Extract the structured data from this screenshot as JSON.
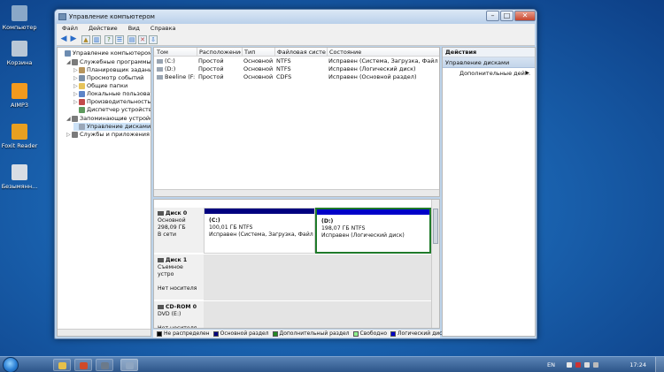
{
  "desktop": {
    "icons": [
      {
        "label": "Компьютер",
        "icon": "computer-icon",
        "color": "#8aa8c8"
      },
      {
        "label": "Корзина",
        "icon": "recycle-bin-icon",
        "color": "#b9c7d6"
      },
      {
        "label": "AIMP3",
        "icon": "aimp-icon",
        "color": "#f39a1e"
      },
      {
        "label": "Foxit Reader",
        "icon": "foxit-reader-icon",
        "color": "#e8a021"
      },
      {
        "label": "Безымянн...",
        "icon": "shortcut-icon",
        "color": "#d8dde4"
      }
    ]
  },
  "window": {
    "title": "Управление компьютером",
    "menu": [
      "Файл",
      "Действие",
      "Вид",
      "Справка"
    ]
  },
  "tree": [
    {
      "label": "Управление компьютером (л",
      "level": 0,
      "icon": "computer-management-icon",
      "color": "#6d8cb1",
      "expand": ""
    },
    {
      "label": "Служебные программы",
      "level": 1,
      "icon": "tools-icon",
      "color": "#7b7b7b",
      "expand": "◢"
    },
    {
      "label": "Планировщик заданий",
      "level": 2,
      "icon": "task-scheduler-icon",
      "color": "#b7955c",
      "expand": "▷"
    },
    {
      "label": "Просмотр событий",
      "level": 2,
      "icon": "event-viewer-icon",
      "color": "#7a8fa8",
      "expand": "▷"
    },
    {
      "label": "Общие папки",
      "level": 2,
      "icon": "shared-folders-icon",
      "color": "#e6c35a",
      "expand": "▷"
    },
    {
      "label": "Локальные пользовате",
      "level": 2,
      "icon": "users-icon",
      "color": "#5c84c8",
      "expand": "▷"
    },
    {
      "label": "Производительность",
      "level": 2,
      "icon": "performance-icon",
      "color": "#c24a4a",
      "expand": "▷"
    },
    {
      "label": "Диспетчер устройств",
      "level": 2,
      "icon": "device-manager-icon",
      "color": "#5d9a5d",
      "expand": ""
    },
    {
      "label": "Запоминающие устройст",
      "level": 1,
      "icon": "storage-icon",
      "color": "#7b7b7b",
      "expand": "◢"
    },
    {
      "label": "Управление дисками",
      "level": 2,
      "icon": "disk-management-icon",
      "color": "#9aa7b8",
      "expand": "",
      "selected": true
    },
    {
      "label": "Службы и приложения",
      "level": 1,
      "icon": "services-icon",
      "color": "#7b7b7b",
      "expand": "▷"
    }
  ],
  "volumes": {
    "columns": [
      "Том",
      "Расположение",
      "Тип",
      "Файловая система",
      "Состояние"
    ],
    "rows": [
      [
        "(C:)",
        "Простой",
        "Основной",
        "NTFS",
        "Исправен (Система, Загрузка, Файл подк"
      ],
      [
        "(D:)",
        "Простой",
        "Основной",
        "NTFS",
        "Исправен (Логический диск)"
      ],
      [
        "Beeline (F:)",
        "Простой",
        "Основной",
        "CDFS",
        "Исправен (Основной раздел)"
      ]
    ]
  },
  "disks": [
    {
      "name": "Диск 0",
      "lines": [
        "Основной",
        "298,09 ГБ",
        "В сети"
      ],
      "icon": "hard-disk-icon",
      "partitions": [
        {
          "name": "(C:)",
          "size": "100,01 ГБ NTFS",
          "status": "Исправен (Система, Загрузка, Файл пс",
          "bar_color": "#00007f",
          "selected": false
        },
        {
          "name": "(D:)",
          "size": "198,07 ГБ NTFS",
          "status": "Исправен (Логический диск)",
          "bar_color": "#0000c8",
          "selected": true
        }
      ]
    },
    {
      "name": "Диск 1",
      "lines": [
        "Съемное устро",
        "",
        "Нет носителя"
      ],
      "icon": "removable-disk-icon",
      "partitions": []
    },
    {
      "name": "CD-ROM 0",
      "lines": [
        "DVD (E:)",
        "",
        "Нет носителя"
      ],
      "icon": "cdrom-icon",
      "partitions": []
    }
  ],
  "legend": [
    {
      "label": "Не распределен",
      "color": "#000000"
    },
    {
      "label": "Основной раздел",
      "color": "#00007f"
    },
    {
      "label": "Дополнительный раздел",
      "color": "#228b22"
    },
    {
      "label": "Свободно",
      "color": "#8cf08c"
    },
    {
      "label": "Логический диск",
      "color": "#0000c8"
    }
  ],
  "actions": {
    "header": "Действия",
    "section": "Управление дисками",
    "item": "Дополнительные дей...",
    "item_arrow": "▶"
  },
  "taskbar": {
    "lang": "EN",
    "time": "17:24",
    "buttons": [
      {
        "icon": "explorer-icon",
        "color": "#e5c04a"
      },
      {
        "icon": "browser-icon",
        "color": "#d04a2a"
      },
      {
        "icon": "network-app-icon",
        "color": "#6c7a8a"
      },
      {
        "icon": "computer-management-icon",
        "color": "#8fa6c2"
      }
    ]
  },
  "accent": "#2b6cc4"
}
